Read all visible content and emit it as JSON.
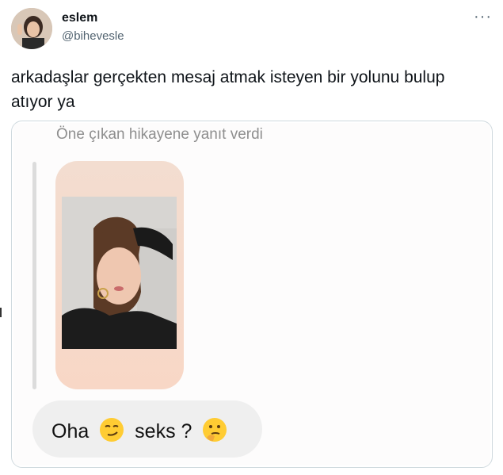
{
  "author": {
    "name": "eslem",
    "handle": "@bihevesle"
  },
  "tweet": {
    "text": "arkadaşlar gerçekten mesaj atmak isteyen bir yolunu bulup atıyor ya"
  },
  "menu": {
    "icon": "more-icon",
    "glyph": "···"
  },
  "embed": {
    "header": "Öne çıkan hikayene yanıt verdi",
    "reply_part1": "Oha",
    "reply_part2": "seks ?",
    "emoji1": "smirk-emoji-icon",
    "emoji2": "thinking-emoji-icon"
  }
}
